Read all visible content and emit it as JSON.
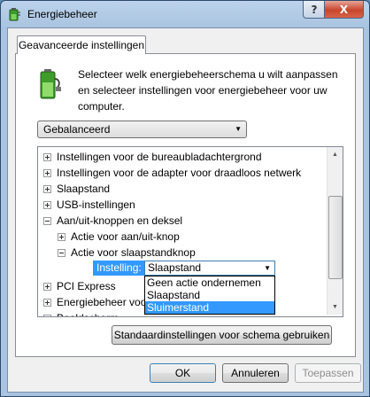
{
  "window": {
    "title": "Energiebeheer"
  },
  "titlebar": {
    "help_label": "?",
    "close_label": "X"
  },
  "tab": {
    "label": "Geavanceerde instellingen"
  },
  "description": "Selecteer welk energiebeheerschema u wilt aanpassen en selecteer instellingen voor energiebeheer voor uw computer.",
  "plan_select": {
    "value": "Gebalanceerd"
  },
  "tree": {
    "items": [
      {
        "label": "Instellingen voor de bureaubladachtergrond",
        "expander": "plus"
      },
      {
        "label": "Instellingen voor de adapter voor draadloos netwerk",
        "expander": "plus"
      },
      {
        "label": "Slaapstand",
        "expander": "plus"
      },
      {
        "label": "USB-instellingen",
        "expander": "plus"
      },
      {
        "label": "Aan/uit-knoppen en deksel",
        "expander": "minus"
      },
      {
        "label": "Actie voor aan/uit-knop",
        "expander": "plus"
      },
      {
        "label": "Actie voor slaapstandknop",
        "expander": "minus"
      },
      {
        "label": "PCI Express",
        "expander": "plus"
      },
      {
        "label": "Energiebeheer voo",
        "expander": "plus"
      },
      {
        "label": "Beeldscherm",
        "expander": "plus"
      }
    ],
    "setting_label": "Instelling:",
    "setting_value": "Slaapstand",
    "dropdown_options": [
      "Geen actie ondernemen",
      "Slaapstand",
      "Sluimerstand"
    ],
    "dropdown_selected": "Sluimerstand"
  },
  "buttons": {
    "defaults": "Standaardinstellingen voor schema gebruiken",
    "ok": "OK",
    "cancel": "Annuleren",
    "apply": "Toepassen"
  },
  "icons": {
    "app": "battery-power-icon",
    "battery": "battery-plug-icon",
    "scroll_up": "scroll-up-arrow-icon",
    "scroll_down": "scroll-down-arrow-icon"
  },
  "colors": {
    "selection": "#3399ff",
    "window_frame": "#a9c4e1"
  }
}
